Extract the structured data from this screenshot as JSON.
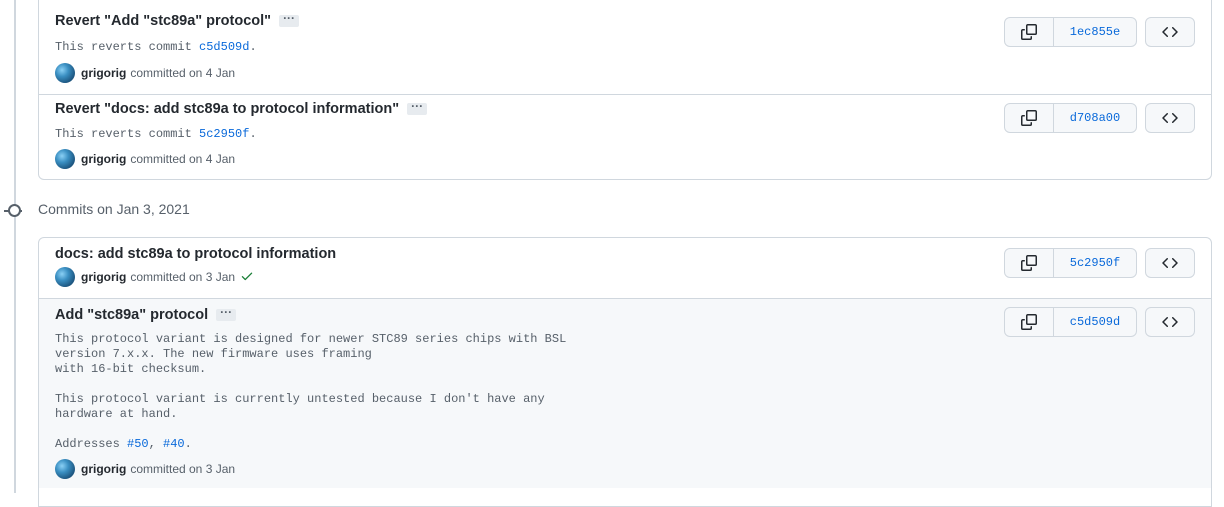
{
  "group1": {
    "commits": [
      {
        "title": "Revert \"Add \"stc89a\" protocol\"",
        "body_prefix": "This reverts commit ",
        "body_link": "c5d509d",
        "body_suffix": ".",
        "author": "grigorig",
        "date_text": "committed on 4 Jan",
        "sha": "1ec855e"
      },
      {
        "title": "Revert \"docs: add stc89a to protocol information\"",
        "body_prefix": "This reverts commit ",
        "body_link": "5c2950f",
        "body_suffix": ".",
        "author": "grigorig",
        "date_text": "committed on 4 Jan",
        "sha": "d708a00"
      }
    ]
  },
  "day_header": "Commits on Jan 3, 2021",
  "group2": {
    "commits": [
      {
        "title": "docs: add stc89a to protocol information",
        "author": "grigorig",
        "date_text": "committed on 3 Jan",
        "sha": "5c2950f",
        "status": "success"
      },
      {
        "title": "Add \"stc89a\" protocol",
        "body_lines": [
          "This protocol variant is designed for newer STC89 series chips with BSL",
          "version 7.x.x. The new firmware uses framing",
          "with 16-bit checksum.",
          "",
          "This protocol variant is currently untested because I don't have any",
          "hardware at hand.",
          ""
        ],
        "addresses_prefix": "Addresses ",
        "issue1": "#50",
        "issue_sep": ", ",
        "issue2": "#40",
        "addresses_suffix": ".",
        "author": "grigorig",
        "date_text": "committed on 3 Jan",
        "sha": "c5d509d"
      }
    ]
  },
  "colors": {
    "link": "#0969da",
    "success": "#1a7f37",
    "border": "#d0d7de",
    "hover_bg": "#f6f8fa"
  },
  "icons": {
    "copy": "copy-icon",
    "browse": "code-icon",
    "status": "check-icon",
    "timeline": "git-commit-icon"
  }
}
